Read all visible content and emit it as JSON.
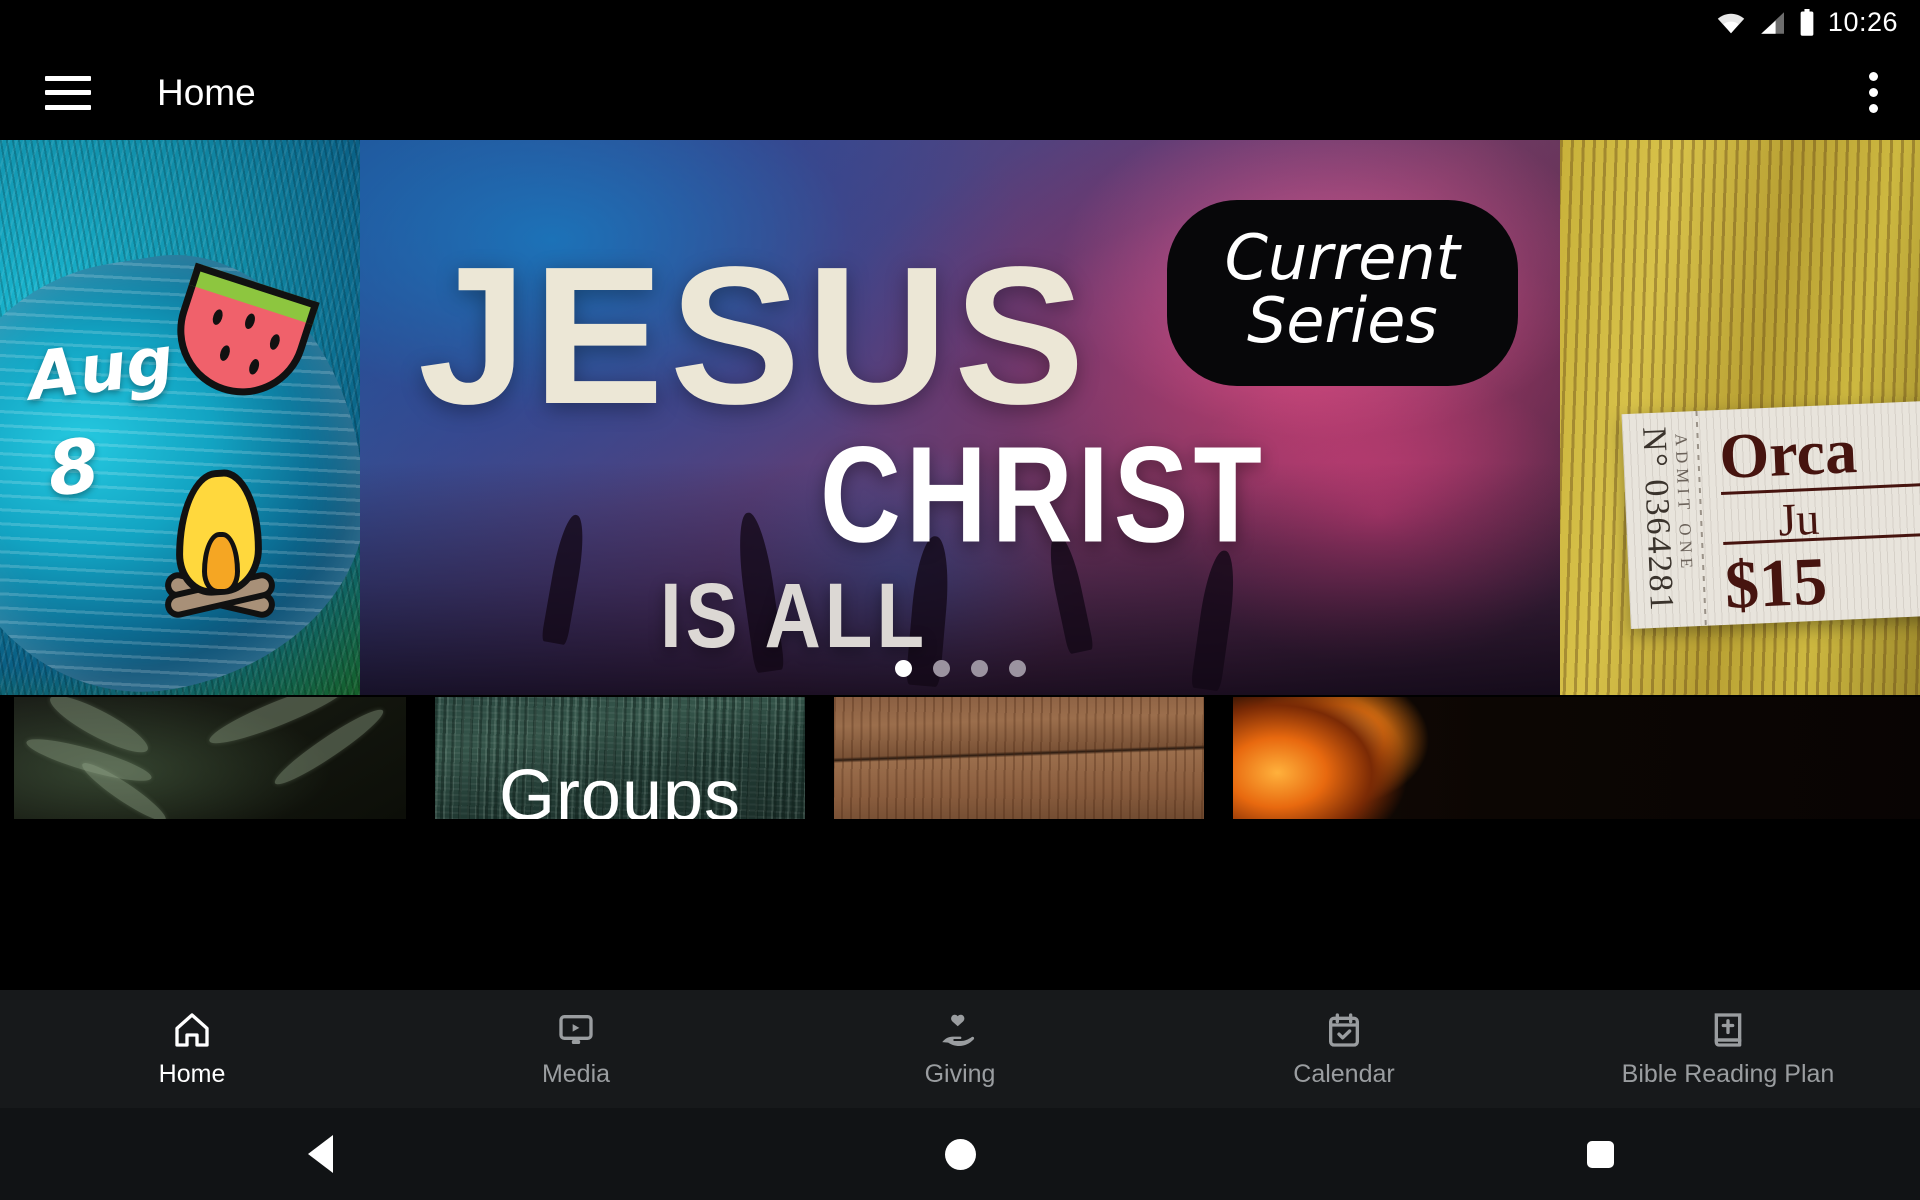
{
  "status_bar": {
    "clock": "10:26",
    "icons": [
      "wifi-icon",
      "cellular-signal-icon",
      "battery-icon"
    ]
  },
  "app_bar": {
    "menu_icon": "hamburger-menu-icon",
    "title": "Home",
    "overflow_icon": "overflow-menu-icon"
  },
  "carousel": {
    "active_index": 0,
    "dot_count": 4,
    "slides": [
      {
        "name": "summer-event-slide",
        "month": "Aug",
        "day": "8",
        "art": [
          "watermelon-slice",
          "campfire",
          "grass",
          "water"
        ]
      },
      {
        "name": "current-series-slide",
        "line1": "JESUS",
        "line2": "CHRIST",
        "line3": "IS ALL",
        "badge_line1": "Current",
        "badge_line2": "Series"
      },
      {
        "name": "event-ticket-slide",
        "ticket_number": "N° 0364281",
        "admit": "ADMIT ONE",
        "title": "Orca",
        "date": "Ju",
        "price": "$15"
      }
    ]
  },
  "cards": [
    {
      "name": "fern-card",
      "label": ""
    },
    {
      "name": "groups-card",
      "label": "Groups"
    },
    {
      "name": "wood-card",
      "label": ""
    },
    {
      "name": "fire-card",
      "label": ""
    }
  ],
  "bottom_nav": {
    "items": [
      {
        "label": "Home",
        "icon": "home-icon",
        "active": true
      },
      {
        "label": "Media",
        "icon": "media-play-icon",
        "active": false
      },
      {
        "label": "Giving",
        "icon": "giving-hand-heart-icon",
        "active": false
      },
      {
        "label": "Calendar",
        "icon": "calendar-check-icon",
        "active": false
      },
      {
        "label": "Bible Reading Plan",
        "icon": "bible-book-icon",
        "active": false
      }
    ],
    "active_color": "#ffffff",
    "inactive_color": "#9a9da0",
    "background": "#17191b"
  },
  "android_nav": {
    "back": "back-triangle-icon",
    "home": "home-circle-icon",
    "recents": "recents-square-icon"
  }
}
